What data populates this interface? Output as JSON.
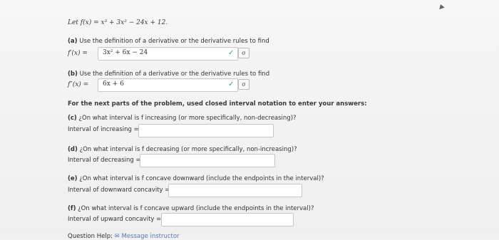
{
  "header": {
    "function_def": "Let f(x) = x³ + 3x² − 24x + 12."
  },
  "part_a": {
    "label": "(a)",
    "text": "Use the definition of a derivative or the derivative rules to find",
    "lhs": "f′(x) =",
    "answer": "3x² + 6x − 24",
    "check": "✓",
    "sigma": "σ"
  },
  "part_b": {
    "label": "(b)",
    "text": "Use the definition of a derivative or the derivative rules to find",
    "lhs": "f″(x) =",
    "answer": "6x + 6",
    "check": "✓",
    "sigma": "σ"
  },
  "instructions": "For the next parts of the problem, used closed interval notation to enter your answers:",
  "part_c": {
    "label": "(c)",
    "question": "¿On what interval is f increasing (or more specifically, non-decreasing)?",
    "field_label": "Interval of increasing ="
  },
  "part_d": {
    "label": "(d)",
    "question": "¿On what interval is f decreasing (or more specifically, non-increasing)?",
    "field_label": "Interval of decreasing ="
  },
  "part_e": {
    "label": "(e)",
    "question": "¿On what interval is f concave downward (include the endpoints in the interval)?",
    "field_label": "Interval of downward concavity ="
  },
  "part_f": {
    "label": "(f)",
    "question": "¿On what interval is f concave upward (include the endpoints in the interval)?",
    "field_label": "Interval of upward concavity ="
  },
  "footer": {
    "help_label": "Question Help:",
    "message_label": "Message instructor"
  }
}
